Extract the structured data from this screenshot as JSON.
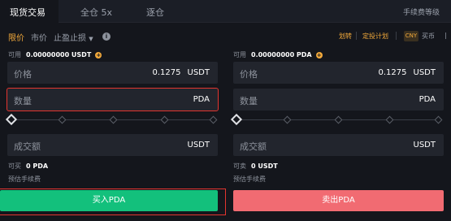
{
  "tabs": [
    {
      "label": "现货交易",
      "active": true
    },
    {
      "label": "全仓 5x",
      "active": false
    },
    {
      "label": "逐仓",
      "active": false
    }
  ],
  "fee_schedule_link": "手续费等级",
  "order_types": {
    "limit": "限价",
    "market": "市价",
    "stop": "止盈止损"
  },
  "links": {
    "transfer": "划转",
    "recurring_plan": "定投计划"
  },
  "currency": {
    "badge": "CNY",
    "label": "买币"
  },
  "buy": {
    "available_label": "可用",
    "available_value": "0.00000000 USDT",
    "price_label": "价格",
    "price_value": "0.1275",
    "price_unit": "USDT",
    "amount_label": "数量",
    "amount_unit": "PDA",
    "total_label": "成交额",
    "total_unit": "USDT",
    "max_label": "可买",
    "max_value": "0 PDA",
    "fee_label": "预估手续费",
    "button": "买入PDA",
    "button_color": "#13c07c"
  },
  "sell": {
    "available_label": "可用",
    "available_value": "0.00000000 PDA",
    "price_label": "价格",
    "price_value": "0.1275",
    "price_unit": "USDT",
    "amount_label": "数量",
    "amount_unit": "PDA",
    "total_label": "成交额",
    "total_unit": "USDT",
    "max_label": "可卖",
    "max_value": "0 USDT",
    "fee_label": "预估手续费",
    "button": "卖出PDA",
    "button_color": "#f16b72"
  },
  "slider_value": 0,
  "accent_color": "#f2a93b",
  "highlight_color": "#e3352f"
}
